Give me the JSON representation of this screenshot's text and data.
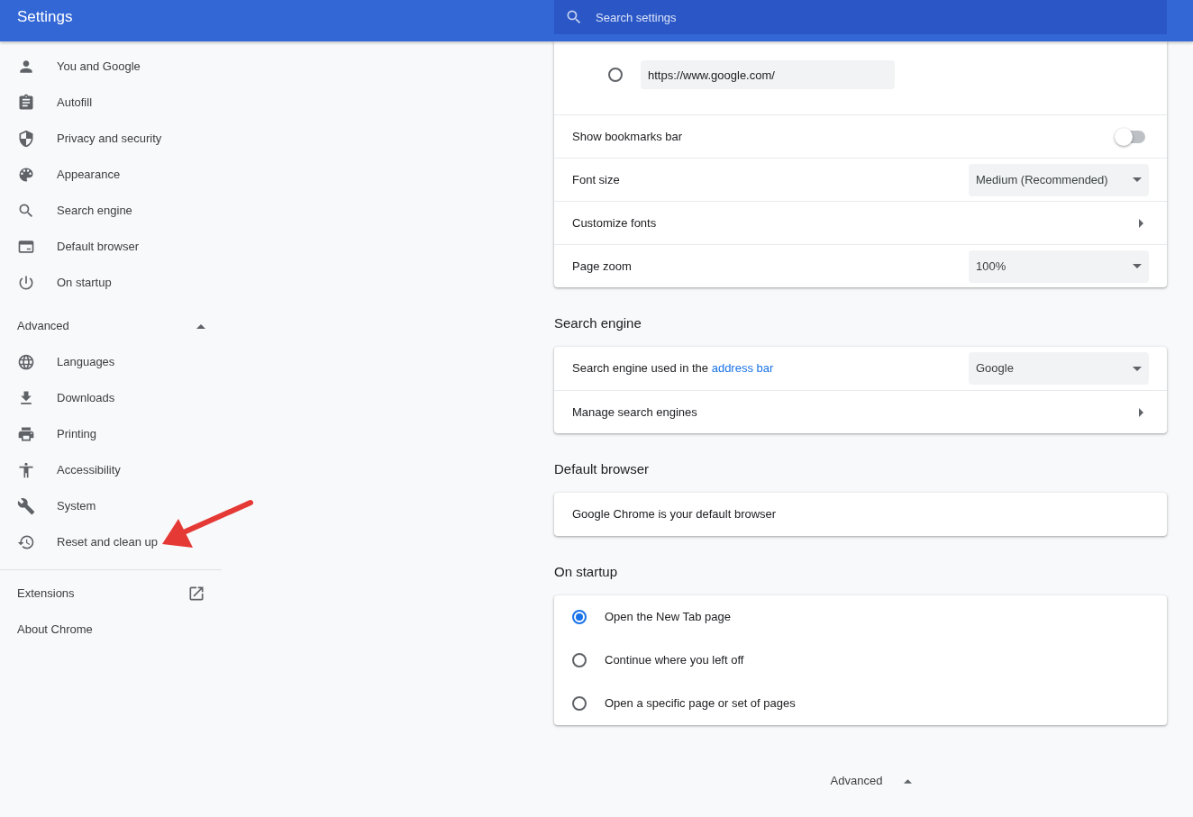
{
  "header": {
    "title": "Settings",
    "search": {
      "placeholder": "Search settings"
    }
  },
  "sidebar": {
    "items": [
      {
        "label": "You and Google",
        "selected": false
      },
      {
        "label": "Autofill",
        "selected": false
      },
      {
        "label": "Privacy and security",
        "selected": false
      },
      {
        "label": "Appearance",
        "selected": false
      },
      {
        "label": "Search engine",
        "selected": false
      },
      {
        "label": "Default browser",
        "selected": false
      },
      {
        "label": "On startup",
        "selected": false
      }
    ],
    "advanced": {
      "label": "Advanced",
      "expanded": true
    },
    "advanced_items": [
      {
        "label": "Languages",
        "selected": false
      },
      {
        "label": "Downloads",
        "selected": false
      },
      {
        "label": "Printing",
        "selected": false
      },
      {
        "label": "Accessibility",
        "selected": false
      },
      {
        "label": "System",
        "selected": false
      },
      {
        "label": "Reset and clean up",
        "selected": false
      }
    ],
    "footer_items": [
      {
        "label": "Extensions",
        "external": true
      },
      {
        "label": "About Chrome",
        "external": false
      }
    ]
  },
  "appearance_card": {
    "rows": [
      {
        "kind": "radio_url",
        "selected": false,
        "value": "https://www.google.com/"
      },
      {
        "kind": "toggle",
        "label": "Show bookmarks bar",
        "on": false
      },
      {
        "kind": "select",
        "label": "Font size",
        "value": "Medium (Recommended)"
      },
      {
        "kind": "link",
        "label": "Customize fonts"
      },
      {
        "kind": "select",
        "label": "Page zoom",
        "value": "100%"
      }
    ]
  },
  "sections": [
    {
      "title": "Search engine",
      "rows": [
        {
          "kind": "select",
          "label": "Search engine used in the",
          "link": "address bar",
          "value": "Google"
        },
        {
          "kind": "link",
          "label": "Manage search engines"
        }
      ]
    },
    {
      "title": "Default browser",
      "rows": [
        {
          "kind": "text",
          "label": "Google Chrome is your default browser"
        }
      ]
    },
    {
      "title": "On startup",
      "rows": [
        {
          "kind": "radio",
          "label": "Open the New Tab page",
          "selected": true
        },
        {
          "kind": "radio",
          "label": "Continue where you left off",
          "selected": false
        },
        {
          "kind": "radio",
          "label": "Open a specific page or set of pages",
          "selected": false
        }
      ]
    }
  ],
  "advanced_button": {
    "label": "Advanced",
    "expanded": true
  }
}
